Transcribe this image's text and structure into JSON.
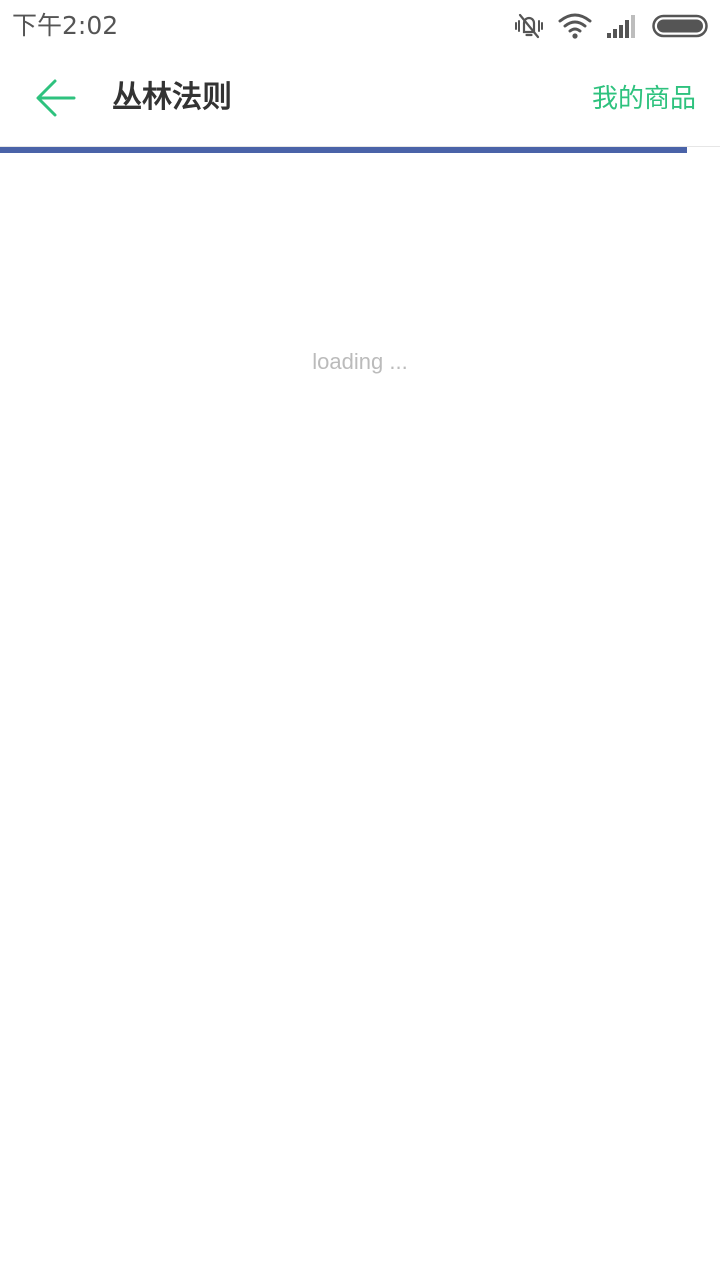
{
  "status_bar": {
    "time": "下午2:02",
    "icons": [
      "vibrate-silent-icon",
      "wifi-icon",
      "cellular-signal-icon",
      "battery-icon"
    ]
  },
  "toolbar": {
    "back_icon": "arrow-left-icon",
    "title": "丛林法则",
    "action_label": "我的商品"
  },
  "progress": {
    "fraction": 0.954
  },
  "content": {
    "loading_text": "loading ..."
  },
  "colors": {
    "accent": "#2ec27e",
    "progress": "#4a63a8",
    "title": "#333333",
    "status_text": "#555555",
    "loading_text": "#bbbbbb"
  }
}
